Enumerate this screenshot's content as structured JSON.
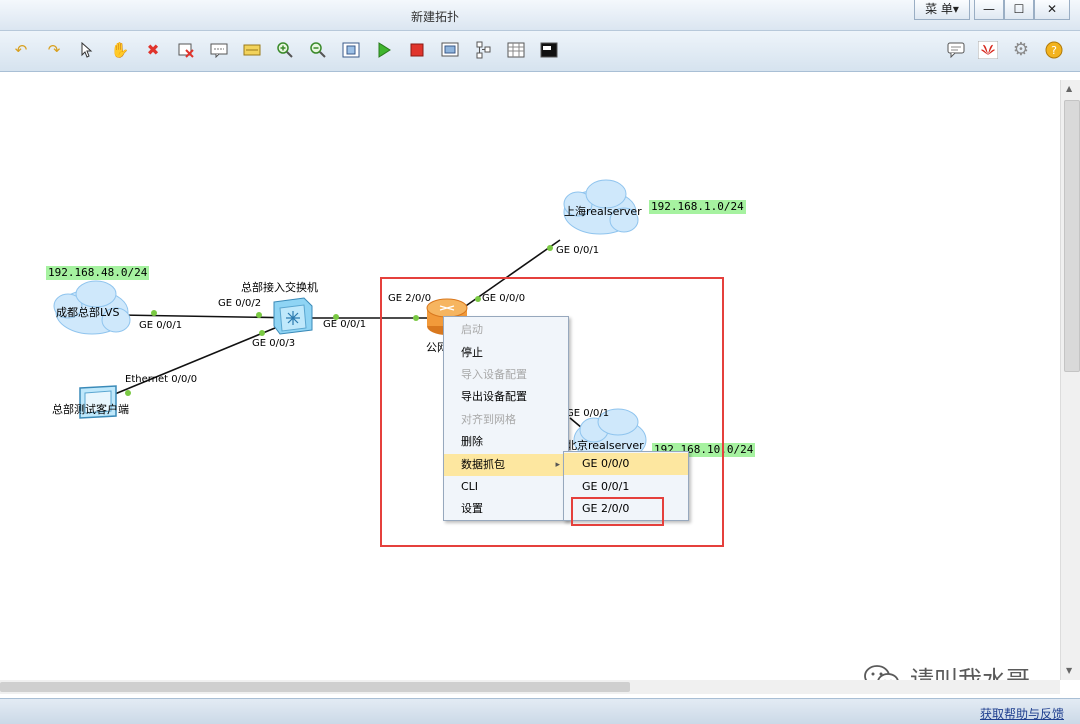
{
  "window": {
    "title": "新建拓扑",
    "menu_label": "菜 单▾",
    "minimize": "—",
    "maximize": "☐",
    "close": "✕"
  },
  "toolbar": {
    "icons": [
      "undo-icon",
      "redo-icon",
      "select-icon",
      "hand-icon",
      "delete-icon",
      "delete-link-icon",
      "text-icon",
      "palette-icon",
      "zoom-in-icon",
      "zoom-out-icon",
      "fit-icon",
      "start-icon",
      "stop-icon",
      "capture-icon",
      "topology-icon",
      "grid-icon",
      "console-icon"
    ],
    "right_icons": [
      "feedback-icon",
      "huawei-icon",
      "settings-icon",
      "help-icon"
    ]
  },
  "topology": {
    "devices": {
      "shanghai": "上海realserver",
      "chengdu": "成都总部LVS",
      "beijing": "北京realserver",
      "switch": "总部接入交换机",
      "client": "总部测试客户端",
      "router": "公网"
    },
    "networks": {
      "shanghai": "192.168.1.0/24",
      "chengdu": "192.168.48.0/24",
      "beijing": "192.168.10.0/24"
    },
    "ports": {
      "shanghai_ge001": "GE 0/0/1",
      "router_ge000": "GE 0/0/0",
      "router_ge200": "GE 2/0/0",
      "sw_ge002": "GE 0/0/2",
      "chengdu_ge001": "GE 0/0/1",
      "sw_ge001": "GE 0/0/1",
      "sw_ge003": "GE 0/0/3",
      "client_eth": "Ethernet 0/0/0",
      "beijing_ge001": "GE 0/0/1"
    }
  },
  "context_menu": {
    "items": [
      {
        "label": "启动",
        "enabled": false
      },
      {
        "label": "停止",
        "enabled": true
      },
      {
        "label": "导入设备配置",
        "enabled": false
      },
      {
        "label": "导出设备配置",
        "enabled": true
      },
      {
        "label": "对齐到网格",
        "enabled": false
      },
      {
        "label": "删除",
        "enabled": true
      },
      {
        "label": "数据抓包",
        "enabled": true,
        "highlighted": true,
        "has_submenu": true
      },
      {
        "label": "CLI",
        "enabled": true
      },
      {
        "label": "设置",
        "enabled": true
      }
    ],
    "submenu": [
      "GE 0/0/0",
      "GE 0/0/1",
      "GE 2/0/0"
    ]
  },
  "watermark": "请叫我水哥",
  "status": {
    "help_link": "获取帮助与反馈"
  },
  "colors": {
    "highlight": "#fde7a0",
    "network_label": "#a6f2a0",
    "annotation_red": "#e5403c",
    "link": "#1f3f8f"
  }
}
